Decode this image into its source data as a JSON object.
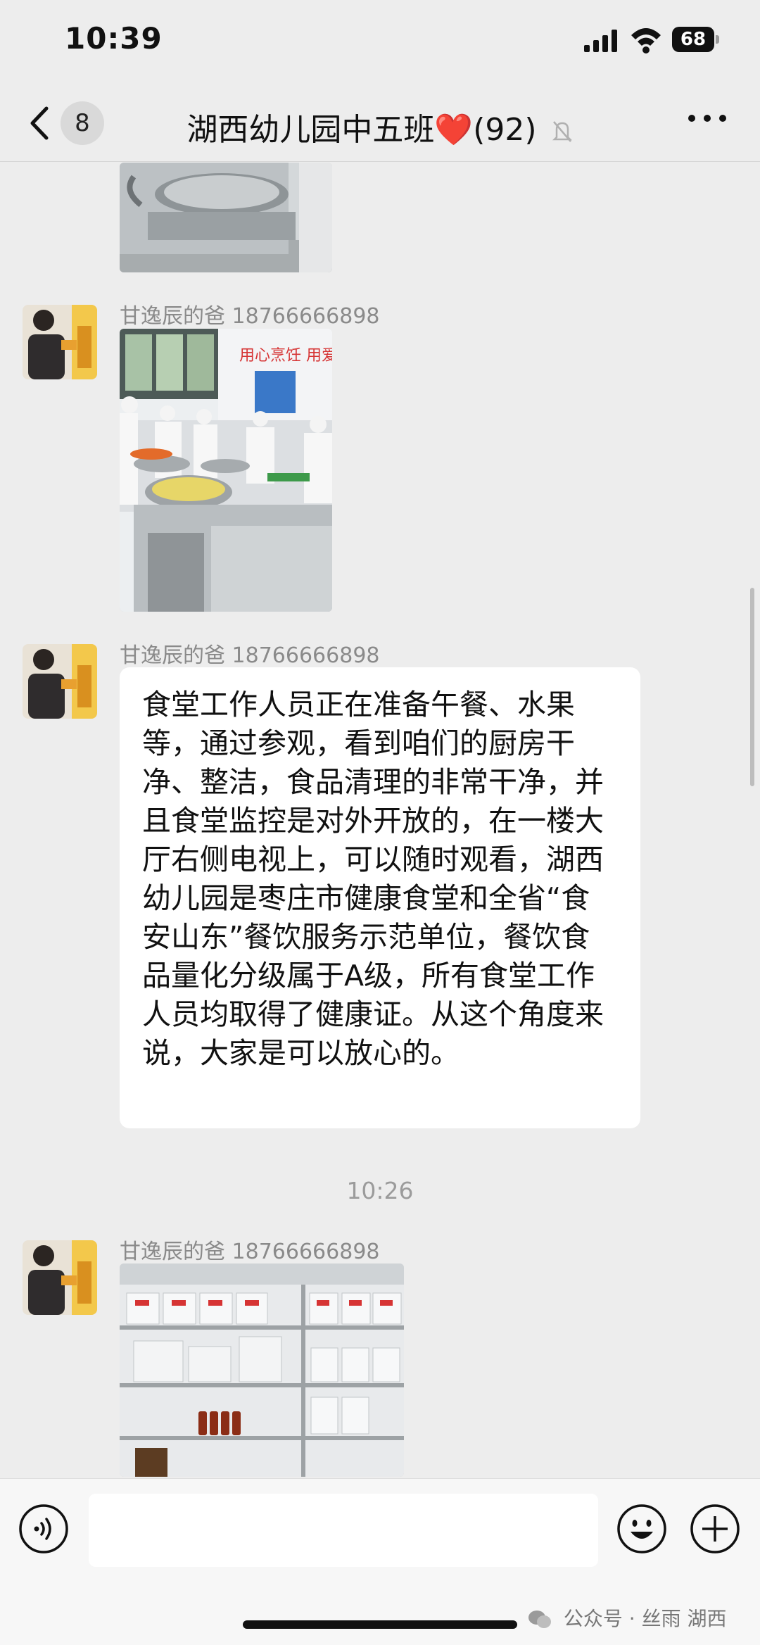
{
  "status": {
    "time": "10:39",
    "battery": "68"
  },
  "nav": {
    "unread_count": "8",
    "title": "湖西幼儿园中五班❤️(92)"
  },
  "messages": [
    {
      "sender": "甘逸辰的爸 18766666898"
    },
    {
      "sender": "甘逸辰的爸 18766666898",
      "text": "食堂工作人员正在准备午餐、水果等，通过参观，看到咱们的厨房干净、整洁，食品清理的非常干净，并且食堂监控是对外开放的，在一楼大厅右侧电视上，可以随时观看，湖西幼儿园是枣庄市健康食堂和全省“食安山东”餐饮服务示范单位，餐饮食品量化分级属于A级，所有食堂工作人员均取得了健康证。从这个角度来说，大家是可以放心的。"
    },
    {
      "sender": "甘逸辰的爸 18766666898"
    }
  ],
  "time_separator": "10:26",
  "watermark": "公众号 · 丝雨 湖西",
  "colors": {
    "background": "#ededed",
    "bubble": "#ffffff",
    "meta_text": "#8a8a8a"
  },
  "icons": [
    "signal-icon",
    "wifi-icon",
    "battery-icon",
    "back-chevron-icon",
    "mute-icon",
    "more-icon",
    "voice-icon",
    "emoji-icon",
    "plus-icon",
    "wechat-icon"
  ]
}
